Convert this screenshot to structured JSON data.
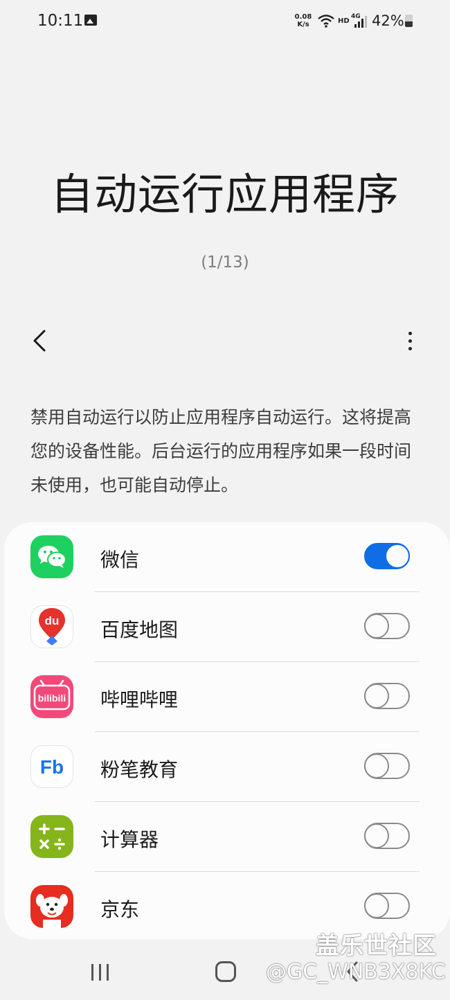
{
  "status_bar": {
    "time": "10:11",
    "net_speed_value": "0.08",
    "net_speed_unit": "K/s",
    "hd_label": "HD",
    "network_type": "4G",
    "battery_text": "42%",
    "battery_level": 0.42
  },
  "header": {
    "title": "自动运行应用程序",
    "counter": "(1/13)"
  },
  "description": "禁用自动运行以防止应用程序自动运行。这将提高您的设备性能。后台运行的应用程序如果一段时间未使用，也可能自动停止。",
  "apps": [
    {
      "name": "微信",
      "enabled": true,
      "icon": "wechat-icon"
    },
    {
      "name": "百度地图",
      "enabled": false,
      "icon": "baidu-map-icon"
    },
    {
      "name": "哔哩哔哩",
      "enabled": false,
      "icon": "bilibili-icon"
    },
    {
      "name": "粉笔教育",
      "enabled": false,
      "icon": "fenbi-icon"
    },
    {
      "name": "计算器",
      "enabled": false,
      "icon": "calculator-icon"
    },
    {
      "name": "京东",
      "enabled": false,
      "icon": "jd-icon"
    }
  ],
  "app_icon_text": {
    "baidu": "du",
    "bilibili": "bilibili",
    "fenbi": "Fb"
  },
  "watermark": {
    "line1": "盖乐世社区",
    "line2": "@GC_WNB3X8KC"
  },
  "colors": {
    "toggle_on": "#0f6ee6",
    "wechat": "#1ed05f",
    "bilibili": "#f2497a",
    "calculator": "#85b51b",
    "jd": "#e62d20"
  }
}
